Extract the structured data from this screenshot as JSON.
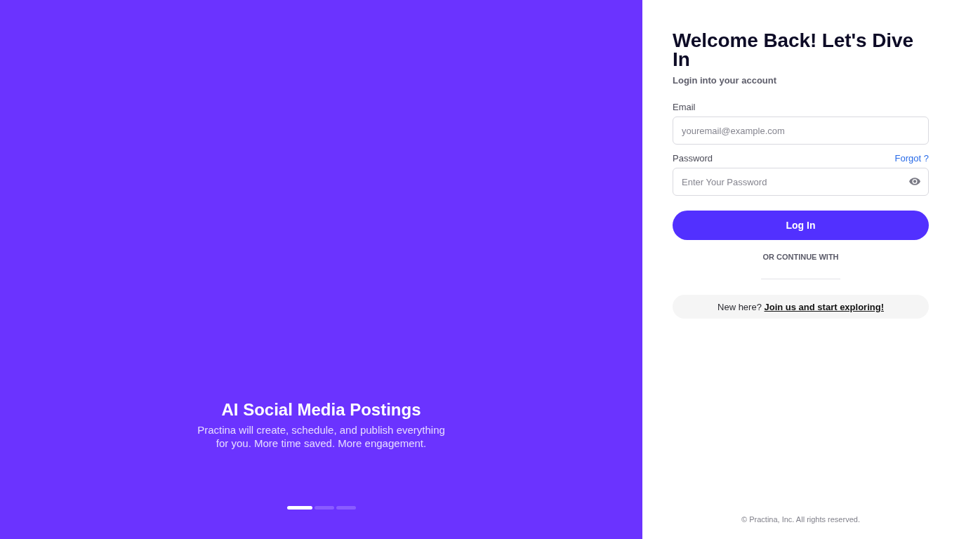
{
  "hero": {
    "title": "AI Social Media Postings",
    "description": "Practina will create, schedule, and publish everything for you. More time saved. More engagement.",
    "slides": [
      {
        "selected": true
      },
      {
        "selected": false
      },
      {
        "selected": false
      }
    ]
  },
  "login": {
    "heading": "Welcome Back! Let's Dive In",
    "subheading": "Login into your account",
    "fields": [
      {
        "kind": "email",
        "label": "Email",
        "placeholder": "youremail@example.com"
      },
      {
        "kind": "password",
        "label": "Password",
        "link": "Forgot ?",
        "placeholder": "Enter Your Password"
      }
    ],
    "submit": "Log In",
    "divider": "OR CONTINUE WITH",
    "signup": {
      "prompt": "New here?",
      "link": "Join us and start exploring!"
    }
  },
  "footer": "© Practina, Inc. All rights reserved."
}
